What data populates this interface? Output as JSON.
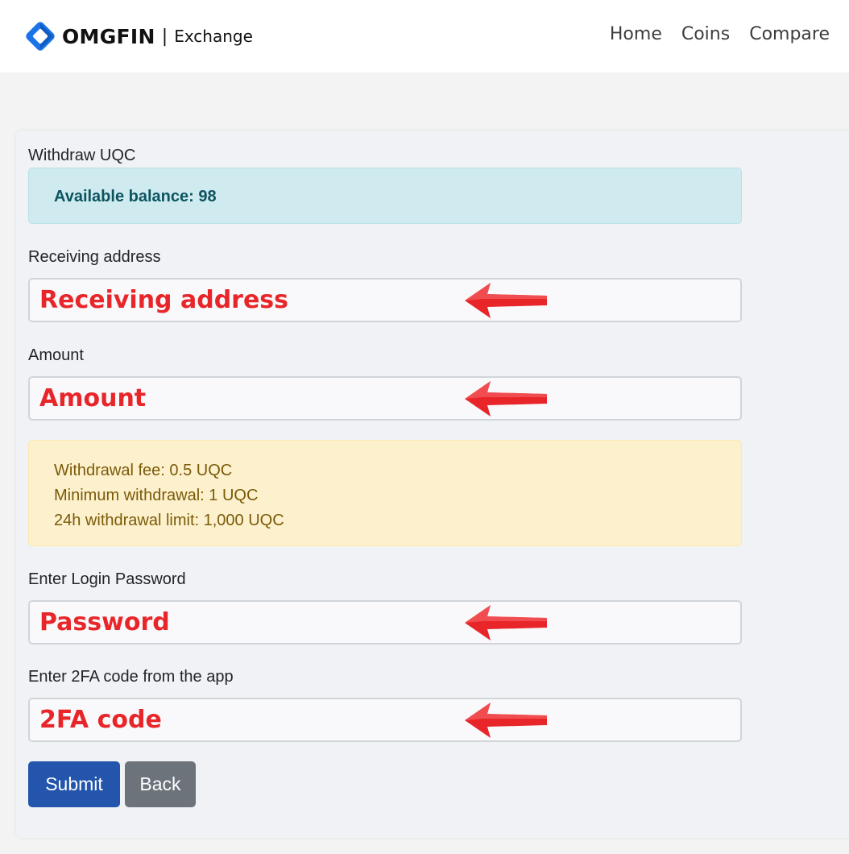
{
  "header": {
    "brand": "OMGFIN",
    "separator": "|",
    "subtitle": "Exchange",
    "nav": [
      "Home",
      "Coins",
      "Compare"
    ]
  },
  "form": {
    "title": "Withdraw UQC",
    "balance_text": "Available balance: 98",
    "address": {
      "label": "Receiving address",
      "placeholder": "Receiving address"
    },
    "amount": {
      "label": "Amount",
      "placeholder": "Amount"
    },
    "fees": [
      "Withdrawal fee: 0.5 UQC",
      "Minimum withdrawal: 1 UQC",
      "24h withdrawal limit: 1,000 UQC"
    ],
    "password": {
      "label": "Enter Login Password",
      "placeholder": "Password"
    },
    "twofa": {
      "label": "Enter 2FA code from the app",
      "placeholder": "2FA code"
    },
    "submit_label": "Submit",
    "back_label": "Back"
  },
  "colors": {
    "primary": "#2355ad",
    "secondary": "#6c737b",
    "annotation_red": "#e8262a",
    "info_bg": "#d0ebf0",
    "warning_bg": "#fdf1cd"
  },
  "icons": {
    "logo": "omgfin-logo-icon",
    "annotation": "red-arrow-left-icon"
  }
}
